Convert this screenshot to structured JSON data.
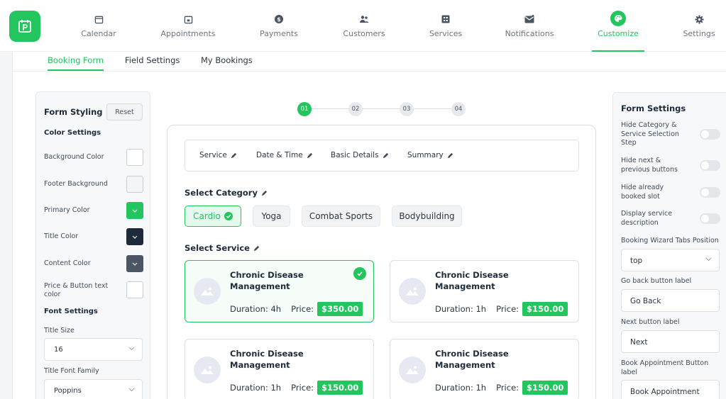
{
  "nav": {
    "items": [
      {
        "label": "Calendar",
        "icon": "calendar-icon"
      },
      {
        "label": "Appointments",
        "icon": "appointments-icon"
      },
      {
        "label": "Payments",
        "icon": "dollar-icon"
      },
      {
        "label": "Customers",
        "icon": "users-icon"
      },
      {
        "label": "Services",
        "icon": "services-icon"
      },
      {
        "label": "Notifications",
        "icon": "envelope-icon"
      },
      {
        "label": "Customize",
        "icon": "palette-icon",
        "active": true
      },
      {
        "label": "Settings",
        "icon": "gear-icon"
      }
    ]
  },
  "subtabs": [
    {
      "label": "Booking Form",
      "active": true
    },
    {
      "label": "Field Settings"
    },
    {
      "label": "My Bookings"
    }
  ],
  "form_styling": {
    "title": "Form Styling",
    "reset_label": "Reset",
    "color_settings_title": "Color Settings",
    "colors": [
      {
        "label": "Background Color",
        "value": "#ffffff"
      },
      {
        "label": "Footer Background",
        "value": "#f4f5f7"
      },
      {
        "label": "Primary Color",
        "value": "#22c55e"
      },
      {
        "label": "Title Color",
        "value": "#1e2a3b"
      },
      {
        "label": "Content Color",
        "value": "#4b5563"
      },
      {
        "label": "Price & Button text color",
        "value": "#ffffff"
      }
    ],
    "font_settings_title": "Font Settings",
    "title_size_label": "Title Size",
    "title_size_value": "16",
    "title_font_family_label": "Title Font Family",
    "title_font_family_value": "Poppins"
  },
  "stepper": [
    "01",
    "02",
    "03",
    "04"
  ],
  "wizard_tabs": [
    "Service",
    "Date & Time",
    "Basic Details",
    "Summary"
  ],
  "select_category": {
    "title": "Select Category",
    "categories": [
      {
        "label": "Cardio",
        "active": true
      },
      {
        "label": "Yoga"
      },
      {
        "label": "Combat Sports"
      },
      {
        "label": "Bodybuilding"
      }
    ]
  },
  "select_service": {
    "title": "Select Service",
    "duration_label": "Duration:",
    "price_label": "Price:",
    "services": [
      {
        "name": "Chronic Disease Management",
        "duration": "4h",
        "price": "$350.00",
        "selected": true
      },
      {
        "name": "Chronic Disease Management",
        "duration": "1h",
        "price": "$150.00"
      },
      {
        "name": "Chronic Disease Management",
        "duration": "1h",
        "price": "$150.00"
      },
      {
        "name": "Chronic Disease Management",
        "duration": "1h",
        "price": "$150.00"
      }
    ]
  },
  "form_settings": {
    "title": "Form Settings",
    "toggles": [
      "Hide Category & Service Selection Step",
      "Hide next & previous buttons",
      "Hide already booked slot",
      "Display service description"
    ],
    "tabs_position_label": "Booking Wizard Tabs Position",
    "tabs_position_value": "top",
    "go_back_label": "Go back button label",
    "go_back_value": "Go Back",
    "next_label": "Next button label",
    "next_value": "Next",
    "book_label": "Book Appointment Button label",
    "book_value": "Book Appointment"
  },
  "colors": {
    "accent": "#22c55e"
  }
}
